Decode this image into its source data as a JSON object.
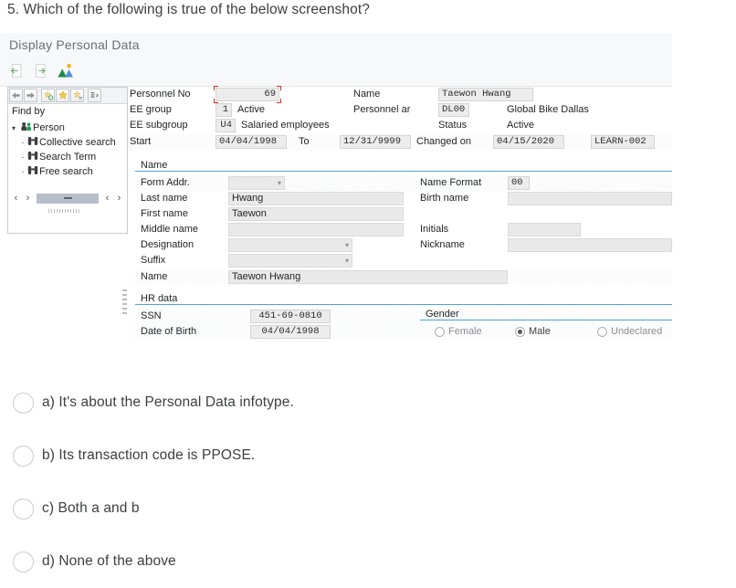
{
  "question": {
    "text": "5. Which of the following is true of the below screenshot?"
  },
  "screenshot": {
    "title": "Display Personal Data",
    "toolbar": [
      {
        "name": "back-arrow-icon",
        "label": "Back"
      },
      {
        "name": "next-arrow-icon",
        "label": "Next"
      },
      {
        "name": "org-structure-icon",
        "label": "Organizational Assignment"
      }
    ],
    "find_panel": {
      "toolbar_icons": [
        {
          "name": "left-arrow-icon"
        },
        {
          "name": "right-arrow-icon"
        },
        {
          "name": "favorite-add-icon"
        },
        {
          "name": "favorite-star-icon"
        },
        {
          "name": "favorite-delete-icon"
        },
        {
          "name": "settings-icon"
        }
      ],
      "heading": "Find by",
      "root": "Person",
      "items": [
        "Collective search",
        "Search Term",
        "Free search"
      ]
    },
    "header": {
      "personnel_no_label": "Personnel No",
      "personnel_no_value": "69",
      "name_label": "Name",
      "name_value": "Taewon Hwang",
      "ee_group_label": "EE group",
      "ee_group_value": "1",
      "ee_group_text": "Active",
      "personnel_area_label": "Personnel ar",
      "personnel_area_value": "DL00",
      "personnel_area_text": "Global Bike Dallas",
      "ee_subgroup_label": "EE subgroup",
      "ee_subgroup_value": "U4",
      "ee_subgroup_text": "Salaried employees",
      "status_label": "Status",
      "status_text": "Active",
      "start_label": "Start",
      "start_value": "04/04/1998",
      "to_label": "To",
      "to_value": "12/31/9999",
      "changed_on_label": "Changed on",
      "changed_on_value": "04/15/2020",
      "changed_by_value": "LEARN-002"
    },
    "name_group": {
      "title": "Name",
      "form_addr_label": "Form Addr.",
      "form_addr_value": "",
      "name_format_label": "Name Format",
      "name_format_value": "00",
      "last_name_label": "Last name",
      "last_name_value": "Hwang",
      "birth_name_label": "Birth name",
      "birth_name_value": "",
      "first_name_label": "First name",
      "first_name_value": "Taewon",
      "middle_name_label": "Middle name",
      "middle_name_value": "",
      "initials_label": "Initials",
      "initials_value": "",
      "designation_label": "Designation",
      "designation_value": "",
      "nickname_label": "Nickname",
      "nickname_value": "",
      "suffix_label": "Suffix",
      "suffix_value": "",
      "name_label": "Name",
      "name_value": "Taewon Hwang"
    },
    "hr_group": {
      "title": "HR data",
      "ssn_label": "SSN",
      "ssn_value": "451-69-0810",
      "dob_label": "Date of Birth",
      "dob_value": "04/04/1998",
      "gender_title": "Gender",
      "gender_options": [
        {
          "label": "Female",
          "selected": false
        },
        {
          "label": "Male",
          "selected": true
        },
        {
          "label": "Undeclared",
          "selected": false
        }
      ]
    }
  },
  "options": [
    {
      "id": "a",
      "label": "a) It's about the Personal Data infotype.",
      "selected": false
    },
    {
      "id": "b",
      "label": "b) Its transaction code is PPOSE.",
      "selected": false
    },
    {
      "id": "c",
      "label": "c) Both a and b",
      "selected": false
    },
    {
      "id": "d",
      "label": "d) None of the above",
      "selected": false
    }
  ],
  "colors": {
    "accent": "#4aa3df",
    "required_marker": "#d93025",
    "text": "#3c4043",
    "title_text": "#6a6f75"
  }
}
